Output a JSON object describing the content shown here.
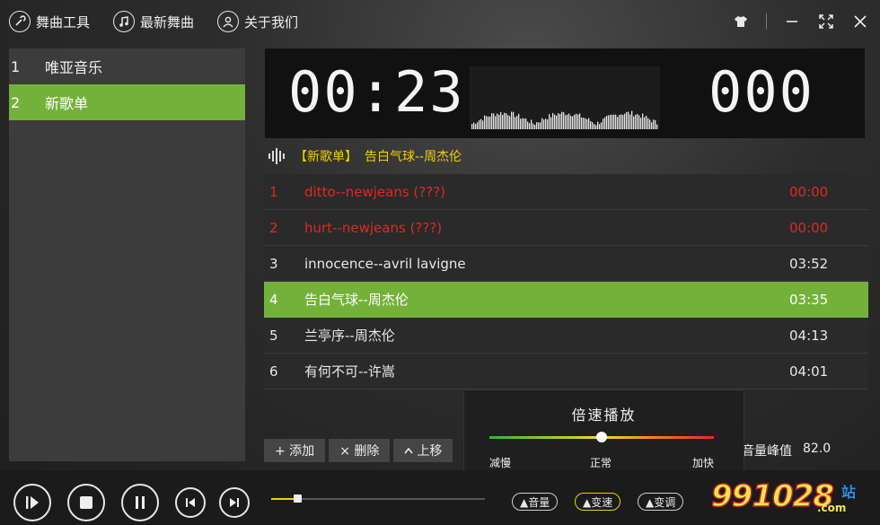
{
  "topnav": [
    {
      "label": "舞曲工具",
      "icon": "wrench-icon"
    },
    {
      "label": "最新舞曲",
      "icon": "music-note-icon"
    },
    {
      "label": "关于我们",
      "icon": "user-icon"
    }
  ],
  "window": {
    "skin_icon": "tshirt-icon",
    "minimize_icon": "minimize-icon",
    "maximize_icon": "fullscreen-icon",
    "close_icon": "close-icon"
  },
  "playlists": [
    {
      "num": "1",
      "name": "唯亚音乐",
      "active": false
    },
    {
      "num": "2",
      "name": "新歌单",
      "active": true
    }
  ],
  "display": {
    "time": "00:23",
    "counter": "000"
  },
  "nowplaying": {
    "playlist": "【新歌单】",
    "track": "告白气球--周杰伦"
  },
  "tracks": [
    {
      "num": "1",
      "title": "ditto--newjeans (???)",
      "duration": "00:00",
      "state": "red"
    },
    {
      "num": "2",
      "title": "hurt--newjeans (???)",
      "duration": "00:00",
      "state": "red"
    },
    {
      "num": "3",
      "title": "innocence--avril lavigne",
      "duration": "03:52",
      "state": "normal"
    },
    {
      "num": "4",
      "title": "告白气球--周杰伦",
      "duration": "03:35",
      "state": "active"
    },
    {
      "num": "5",
      "title": "兰亭序--周杰伦",
      "duration": "04:13",
      "state": "normal"
    },
    {
      "num": "6",
      "title": "有何不可--许嵩",
      "duration": "04:01",
      "state": "normal"
    }
  ],
  "listbar": {
    "add": "+ 添加",
    "delete": "× 删除",
    "moveup": "上移"
  },
  "peak": {
    "label": "音量峰值",
    "value": "82.0"
  },
  "speed": {
    "title": "倍速播放",
    "slow": "减慢",
    "normal": "正常",
    "fast": "加快",
    "level": 0.5
  },
  "player": {
    "progress": 0.12,
    "volume_pill": "▲音量",
    "speed_pill": "▲变速",
    "pitch_pill": "▲变调"
  },
  "logo": {
    "text": "991028",
    "small": ".com",
    "zhan": "站"
  },
  "colors": {
    "accent_green": "#74b13a",
    "accent_yellow": "#f0d200",
    "error_red": "#e02727"
  }
}
